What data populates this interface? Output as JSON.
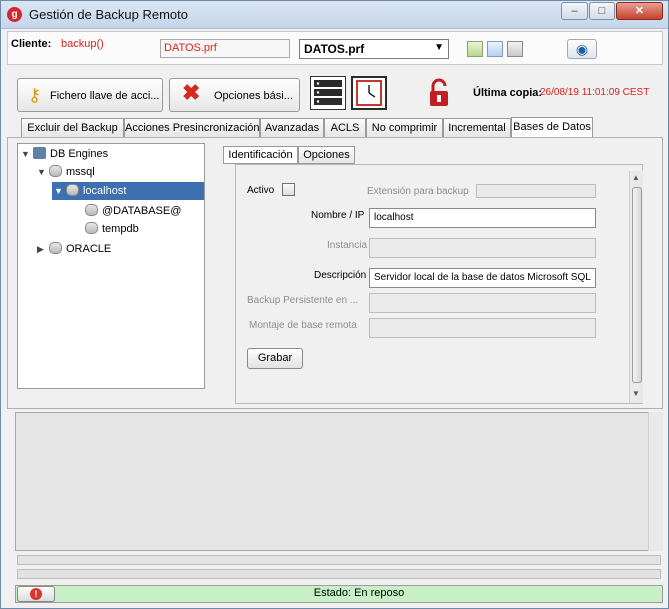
{
  "window": {
    "title": "Gestión de Backup Remoto",
    "minimize": "–",
    "maximize": "□",
    "close": "✕"
  },
  "client": {
    "label": "Cliente:",
    "value": "backup()",
    "file_field": "DATOS.prf",
    "profile_select": "DATOS.prf"
  },
  "toolbar": {
    "key_file_button": "Fichero llave de acci...",
    "basic_options_button": "Opciones bási...",
    "last_copy_label": "Última copia:",
    "last_copy_value": "26/08/19 11:01:09 CEST"
  },
  "tabs": [
    {
      "label": "Excluir del Backup",
      "active": false
    },
    {
      "label": "Acciones Presincronización",
      "active": false
    },
    {
      "label": "Avanzadas",
      "active": false
    },
    {
      "label": "ACLS",
      "active": false
    },
    {
      "label": "No comprimir",
      "active": false
    },
    {
      "label": "Incremental",
      "active": false
    },
    {
      "label": "Bases de Datos",
      "active": true
    }
  ],
  "tree": {
    "items": [
      {
        "label": "DB Engines",
        "expander": "▼"
      },
      {
        "label": "mssql",
        "expander": "▼"
      },
      {
        "label": "localhost",
        "expander": "▼",
        "selected": true
      },
      {
        "label": "@DATABASE@",
        "expander": ""
      },
      {
        "label": "tempdb",
        "expander": ""
      },
      {
        "label": "ORACLE",
        "expander": "▶"
      }
    ]
  },
  "subtabs": [
    {
      "label": "Identificación",
      "active": true
    },
    {
      "label": "Opciones",
      "active": false
    }
  ],
  "form": {
    "activo_label": "Activo",
    "extension_label": "Extensión para backup",
    "extension_value": "",
    "nombre_label": "Nombre / IP",
    "nombre_value": "localhost",
    "instancia_label": "Instancia",
    "instancia_value": "",
    "descripcion_label": "Descripción",
    "descripcion_value": "Servidor local de la base de datos Microsoft SQL",
    "backup_persistente_label": "Backup Persistente en ...",
    "backup_persistente_value": "",
    "montaje_label": "Montaje de base remota",
    "montaje_value": "",
    "grabar_button": "Grabar"
  },
  "status": {
    "text": "Estado: En reposo",
    "alert_symbol": "!"
  },
  "colors": {
    "accent_red": "#e0201c",
    "status_green": "#c7f0c6",
    "selection_blue": "#3e6fb1"
  }
}
